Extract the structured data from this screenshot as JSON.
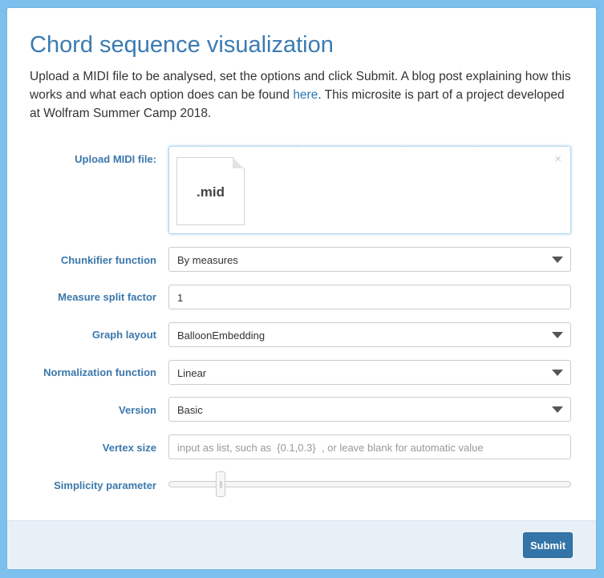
{
  "colors": {
    "background": "#7cc0ee",
    "title": "#3b7bb2",
    "label": "#3b78ab",
    "link": "#2a77b5",
    "submit_bg": "#3375a8",
    "footer_bg": "#e8f0f7"
  },
  "header": {
    "title": "Chord sequence visualization",
    "description_before": "Upload a MIDI file to be analysed, set the options and click Submit. A blog post explaining how this works and what each option does can be found ",
    "description_link": "here",
    "description_after": ". This microsite is part of a project developed at Wolfram Summer Camp 2018."
  },
  "form": {
    "upload": {
      "label": "Upload MIDI file:",
      "file_extension": ".mid",
      "clear_icon": "×"
    },
    "chunkifier": {
      "label": "Chunkifier function",
      "value": "By measures"
    },
    "split_factor": {
      "label": "Measure split factor",
      "value": "1"
    },
    "graph_layout": {
      "label": "Graph layout",
      "value": "BalloonEmbedding"
    },
    "normalization": {
      "label": "Normalization function",
      "value": "Linear"
    },
    "version": {
      "label": "Version",
      "value": "Basic"
    },
    "vertex_size": {
      "label": "Vertex size",
      "placeholder": "input as list, such as  {0.1,0.3}  , or leave blank for automatic value"
    },
    "simplicity": {
      "label": "Simplicity parameter",
      "level": 0.12
    }
  },
  "footer": {
    "submit_label": "Submit"
  },
  "icons": {
    "file": "file-icon",
    "clear": "close-icon",
    "dropdown": "chevron-down-icon",
    "slider": "slider-handle"
  }
}
